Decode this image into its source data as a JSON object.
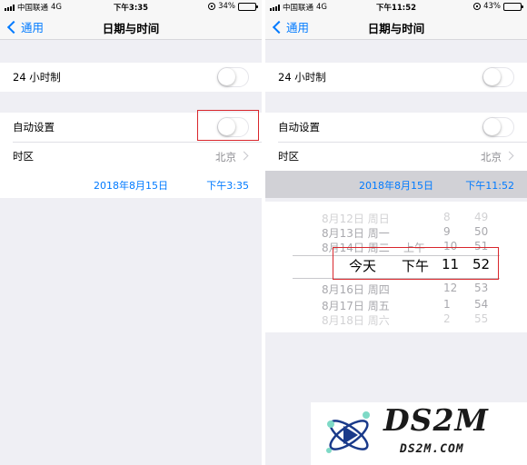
{
  "colors": {
    "accent": "#007aff",
    "highlight": "#d9262c",
    "background": "#efeff4"
  },
  "left": {
    "status": {
      "carrier": "中国联通",
      "network": "4G",
      "time": "下午3:35",
      "battery": "34%",
      "battery_level": 0.34
    },
    "nav": {
      "back_label": "通用",
      "title": "日期与时间"
    },
    "settings": {
      "hour24_label": "24 小时制",
      "auto_set_label": "自动设置",
      "timezone_label": "时区",
      "timezone_value": "北京"
    },
    "datetime": {
      "date": "2018年8月15日",
      "time": "下午3:35"
    }
  },
  "right": {
    "status": {
      "carrier": "中国联通",
      "network": "4G",
      "time": "下午11:52",
      "battery": "43%",
      "battery_level": 0.43
    },
    "nav": {
      "back_label": "通用",
      "title": "日期与时间"
    },
    "settings": {
      "hour24_label": "24 小时制",
      "auto_set_label": "自动设置",
      "timezone_label": "时区",
      "timezone_value": "北京"
    },
    "datetime": {
      "date": "2018年8月15日",
      "time": "下午11:52"
    },
    "picker": {
      "rows": [
        {
          "date": "8月12日 周日",
          "ampm": "",
          "hour": "8",
          "minute": "49"
        },
        {
          "date": "8月13日 周一",
          "ampm": "",
          "hour": "9",
          "minute": "50"
        },
        {
          "date": "8月14日 周二",
          "ampm": "上午",
          "hour": "10",
          "minute": "51"
        },
        {
          "date": "今天",
          "ampm": "下午",
          "hour": "11",
          "minute": "52"
        },
        {
          "date": "8月16日 周四",
          "ampm": "",
          "hour": "12",
          "minute": "53"
        },
        {
          "date": "8月17日 周五",
          "ampm": "",
          "hour": "1",
          "minute": "54"
        },
        {
          "date": "8月18日 周六",
          "ampm": "",
          "hour": "2",
          "minute": "55"
        }
      ]
    }
  },
  "watermark": {
    "brand": "DS2M",
    "domain": "DS2M.COM"
  }
}
